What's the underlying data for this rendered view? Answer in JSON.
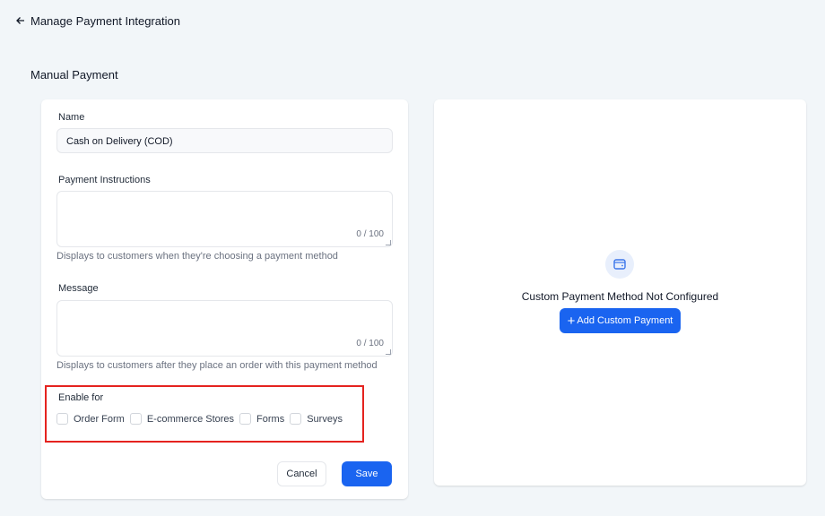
{
  "header": {
    "title": "Manage Payment Integration",
    "back_icon": "arrow-left-icon"
  },
  "section_title": "Manual Payment",
  "form": {
    "name_label": "Name",
    "name_value": "Cash on Delivery (COD)",
    "instructions_label": "Payment Instructions",
    "instructions_value": "",
    "instructions_counter": "0 / 100",
    "instructions_help": "Displays to customers when they're choosing a payment method",
    "message_label": "Message",
    "message_value": "",
    "message_counter": "0 / 100",
    "message_help": "Displays to customers after they place an order with this payment method",
    "enable_label": "Enable for",
    "enable_options": [
      {
        "label": "Order Form",
        "checked": false
      },
      {
        "label": "E-commerce Stores",
        "checked": false
      },
      {
        "label": "Forms",
        "checked": false
      },
      {
        "label": "Surveys",
        "checked": false
      }
    ],
    "cancel_label": "Cancel",
    "save_label": "Save"
  },
  "custom": {
    "icon": "wallet-icon",
    "title": "Custom Payment Method Not Configured",
    "button_label": "Add Custom Payment"
  },
  "colors": {
    "primary": "#1a64f0",
    "highlight": "#e5231f",
    "background": "#f2f6f9"
  }
}
